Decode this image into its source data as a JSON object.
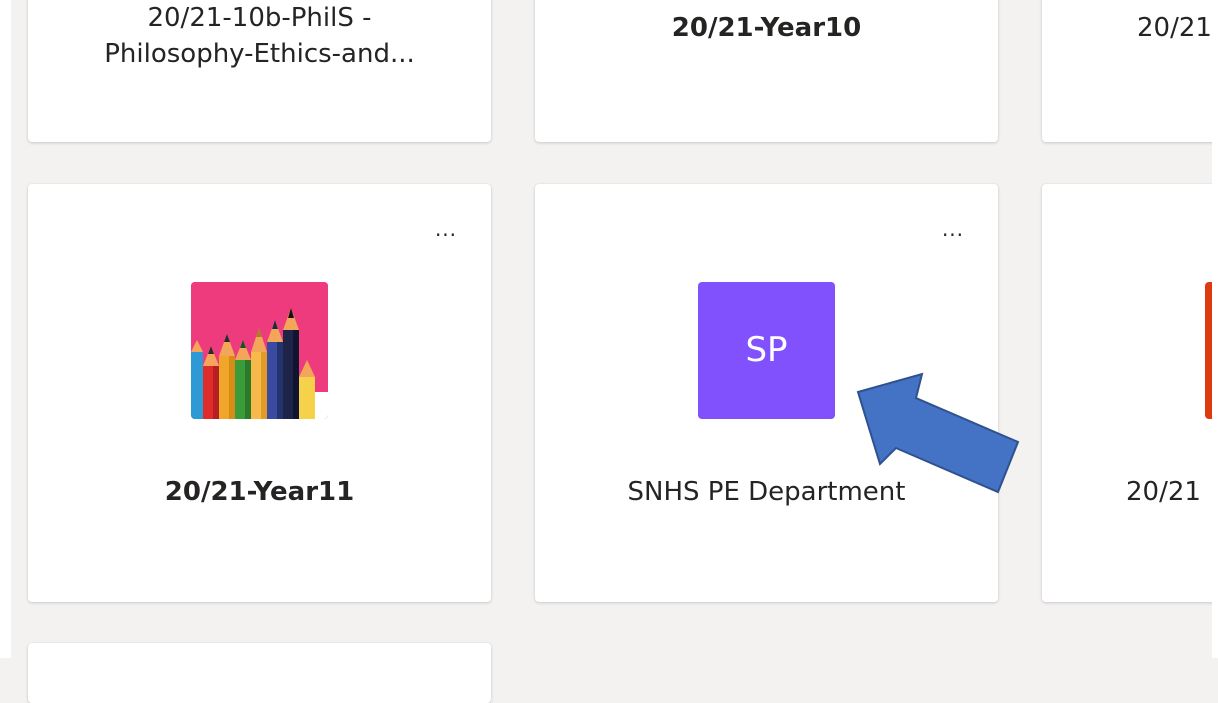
{
  "cards": {
    "philosophy": {
      "title_line1": "20/21-10b-PhilS -",
      "title_line2": "Philosophy-Ethics-and..."
    },
    "year10": {
      "title": "20/21-Year10"
    },
    "top_right": {
      "title": "20/21"
    },
    "year11": {
      "title": "20/21-Year11",
      "more_label": "..."
    },
    "snhs": {
      "title": "SNHS PE Department",
      "initials": "SP",
      "more_label": "..."
    },
    "mid_right": {
      "title": "20/21"
    }
  },
  "annotation": {
    "arrow_color": "#4472c4",
    "arrow_outline": "#2f528f"
  },
  "colors": {
    "sp_tile": "#8151fd",
    "orange_tile": "#dd3a0f",
    "pencil_bg": "#ee3b7e"
  }
}
